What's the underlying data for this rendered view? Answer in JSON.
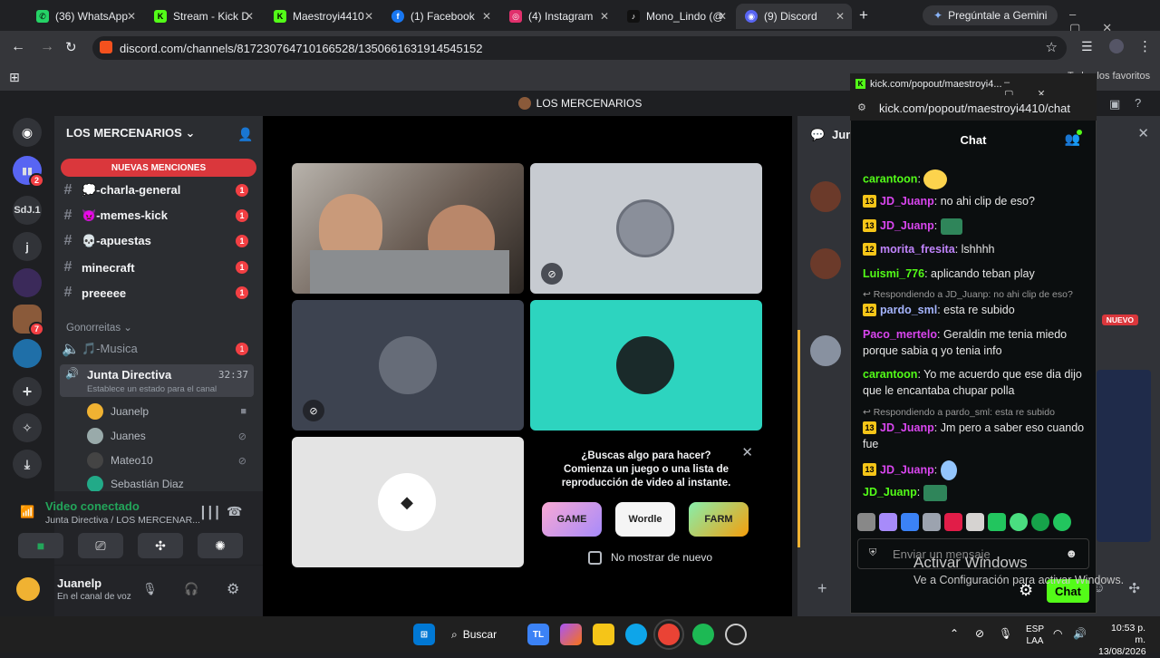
{
  "browser": {
    "tabs": [
      {
        "label": "(36) WhatsApp",
        "color": "#25d366"
      },
      {
        "label": "Stream - Kick D",
        "color": "#53fc18"
      },
      {
        "label": "Maestroyi4410",
        "color": "#53fc18"
      },
      {
        "label": "(1) Facebook",
        "color": "#1877f2"
      },
      {
        "label": "(4) Instagram",
        "color": "#e1306c"
      },
      {
        "label": "Mono_Lindo (@",
        "color": "#000000"
      },
      {
        "label": "(9) Discord",
        "color": "#5865f2"
      }
    ],
    "gemini": "Pregúntale a Gemini",
    "url": "discord.com/channels/817230764710166528/1350661631914545152",
    "bookmarks_hint": "Todos los favoritos"
  },
  "discord": {
    "top_title": "LOS MERCENARIOS",
    "server_name": "LOS MERCENARIOS",
    "guild_labels": [
      "SdJ.1",
      "j"
    ],
    "guild_badges": [
      "2",
      "7"
    ],
    "new_mentions": "NUEVAS MENCIONES",
    "channels": [
      {
        "name": "💭-charla-general",
        "badge": "1"
      },
      {
        "name": "👿-memes-kick",
        "badge": "1"
      },
      {
        "name": "💀-apuestas",
        "badge": "1"
      },
      {
        "name": "minecraft",
        "badge": "1"
      },
      {
        "name": "preeeee",
        "badge": "1"
      }
    ],
    "category": "Gonorreitas",
    "music_channel": {
      "name": "🎵-Musica",
      "badge": "1"
    },
    "voice_channel": {
      "name": "Junta Directiva",
      "time": "32:37",
      "status": "Establece un estado para el canal"
    },
    "voice_users": [
      "Juanelp",
      "Juanes",
      "Mateo10",
      "Sebastián Diaz"
    ],
    "connection": {
      "title": "Video conectado",
      "subtitle": "Junta Directiva / LOS MERCENAR..."
    },
    "user": {
      "name": "Juanelp",
      "status": "En el canal de voz"
    },
    "right_pane": {
      "title": "Jun",
      "new_badge": "NUEVO"
    },
    "activity": {
      "line1": "¿Buscas algo para hacer?",
      "line2": "Comienza un juego o una lista de",
      "line3": "reproducción de video al instante.",
      "games": [
        "GAME",
        "Wordle",
        "FARM"
      ],
      "checkbox": "No mostrar de nuevo"
    }
  },
  "kick": {
    "window_title": "kick.com/popout/maestroyi4...",
    "url": "kick.com/popout/maestroyi4410/chat",
    "header": "Chat",
    "messages": [
      {
        "level": "",
        "user": "carantoon",
        "color": "#53fc18",
        "text": ""
      },
      {
        "level": "13",
        "user": "JD_Juanp",
        "color": "#d946ef",
        "text": "no ahi clip de eso?"
      },
      {
        "level": "13",
        "user": "JD_Juanp",
        "color": "#d946ef",
        "text": ""
      },
      {
        "level": "12",
        "user": "morita_fresita",
        "color": "#c084fc",
        "text": "lshhhh"
      },
      {
        "level": "",
        "user": "Luismi_776",
        "color": "#53fc18",
        "text": "aplicando teban play"
      },
      {
        "level": "12",
        "user": "pardo_sml",
        "color": "#a5b4fc",
        "text": "esta re subido"
      },
      {
        "level": "",
        "user": "Paco_mertelo",
        "color": "#d946ef",
        "text": "Geraldin me tenia miedo porque sabia q yo tenia info"
      },
      {
        "level": "",
        "user": "carantoon",
        "color": "#53fc18",
        "text": "Yo me acuerdo que ese dia dijo que le encantaba chupar polla"
      },
      {
        "level": "13",
        "user": "JD_Juanp",
        "color": "#d946ef",
        "text": "Jm pero a saber eso cuando fue"
      },
      {
        "level": "13",
        "user": "JD_Juanp",
        "color": "#d946ef",
        "text": ""
      },
      {
        "level": "",
        "user": "JD_Juanp",
        "color": "#53fc18",
        "text": ""
      }
    ],
    "replies": [
      "Respondiendo a JD_Juanp: no ahi clip de eso?",
      "Respondiendo a pardo_sml: esta re subido"
    ],
    "input_placeholder": "Enviar un mensaje",
    "send_label": "Chat"
  },
  "windows": {
    "watermark_title": "Activar Windows",
    "watermark_sub": "Ve a Configuración para activar Windows.",
    "search": "Buscar",
    "lang1": "ESP",
    "lang2": "LAA",
    "time": "10:53 p. m.",
    "date": "13/08/2026"
  }
}
